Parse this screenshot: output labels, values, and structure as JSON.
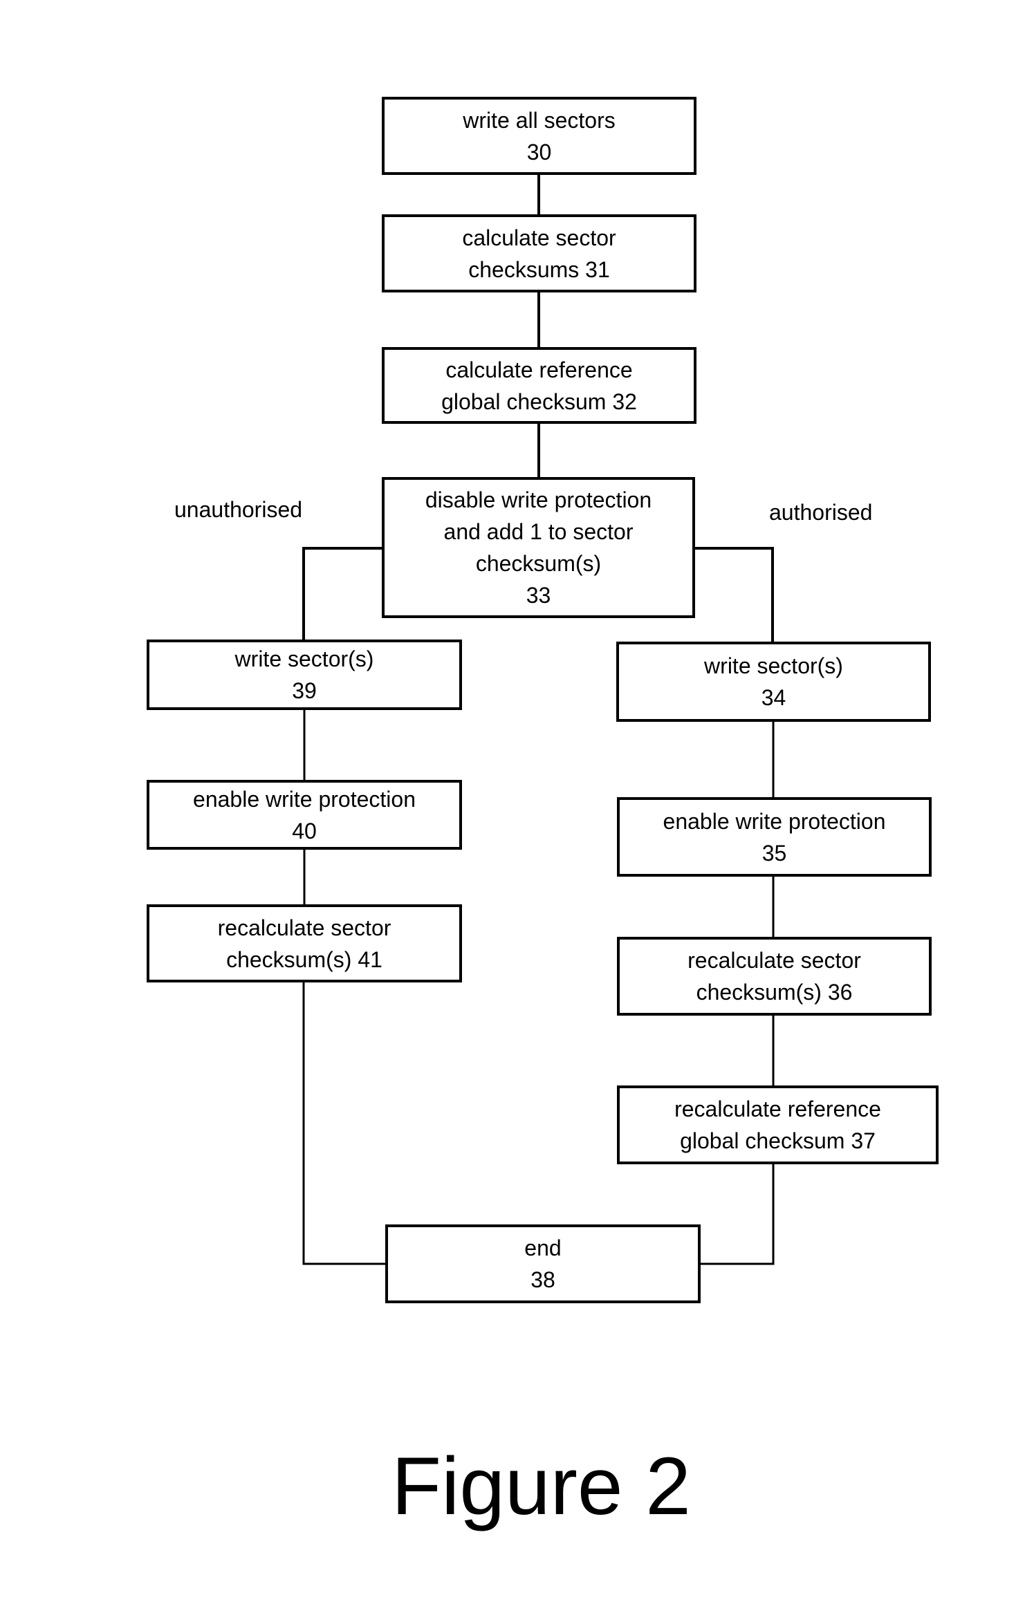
{
  "figure": {
    "caption": "Figure 2",
    "branch_labels": {
      "left": "unauthorised",
      "right": "authorised"
    },
    "steps": [
      {
        "id": "30",
        "lines": [
          "write all sectors",
          "30"
        ]
      },
      {
        "id": "31",
        "lines": [
          "calculate sector",
          "checksums 31"
        ]
      },
      {
        "id": "32",
        "lines": [
          "calculate reference",
          "global checksum 32"
        ]
      },
      {
        "id": "33",
        "lines": [
          "disable write protection",
          "and add 1 to sector",
          "checksum(s)",
          "33"
        ]
      },
      {
        "id": "39",
        "lines": [
          "write sector(s)",
          "39"
        ]
      },
      {
        "id": "40",
        "lines": [
          "enable write protection",
          "40"
        ]
      },
      {
        "id": "41",
        "lines": [
          "recalculate sector",
          "checksum(s) 41"
        ]
      },
      {
        "id": "34",
        "lines": [
          "write sector(s)",
          "34"
        ]
      },
      {
        "id": "35",
        "lines": [
          "enable write protection",
          "35"
        ]
      },
      {
        "id": "36",
        "lines": [
          "recalculate sector",
          "checksum(s) 36"
        ]
      },
      {
        "id": "37",
        "lines": [
          "recalculate reference",
          "global checksum 37"
        ]
      },
      {
        "id": "38",
        "lines": [
          "end",
          "38"
        ]
      }
    ],
    "connections": [
      [
        "30",
        "31"
      ],
      [
        "31",
        "32"
      ],
      [
        "32",
        "33"
      ],
      [
        "33",
        "39"
      ],
      [
        "39",
        "40"
      ],
      [
        "40",
        "41"
      ],
      [
        "41",
        "38"
      ],
      [
        "33",
        "34"
      ],
      [
        "34",
        "35"
      ],
      [
        "35",
        "36"
      ],
      [
        "36",
        "37"
      ],
      [
        "37",
        "38"
      ]
    ]
  }
}
